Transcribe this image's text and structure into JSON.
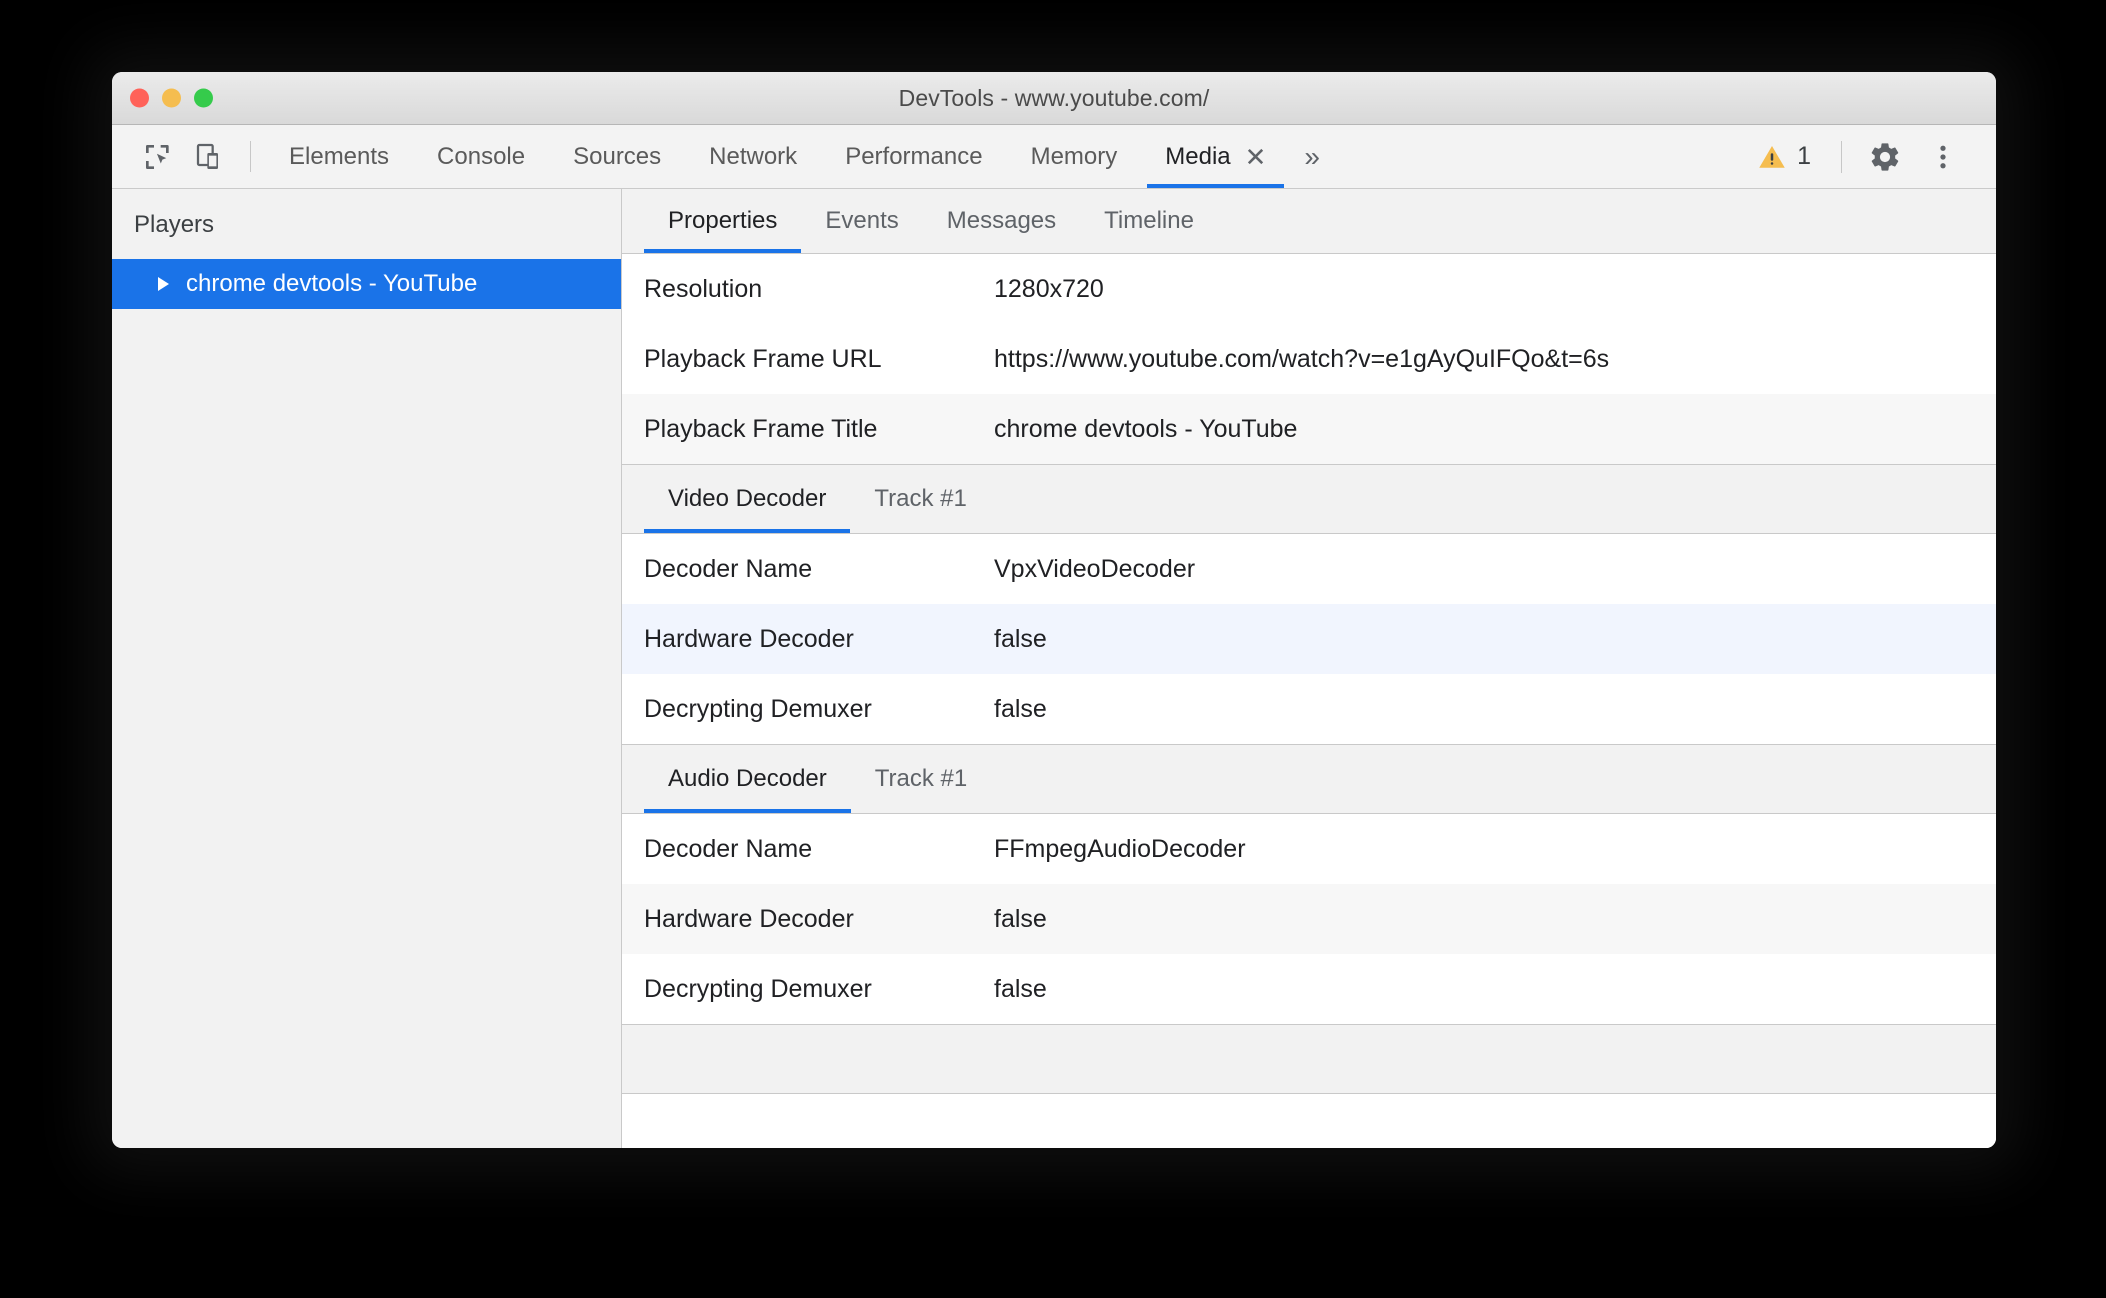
{
  "window": {
    "title": "DevTools - www.youtube.com/",
    "traffic_lights": [
      "close-red",
      "minimize-yellow",
      "zoom-green"
    ]
  },
  "toolbar": {
    "icons": [
      {
        "name": "inspect-element-icon",
        "label": "Inspect element"
      },
      {
        "name": "device-toolbar-icon",
        "label": "Toggle device toolbar"
      }
    ],
    "tabs": [
      {
        "label": "Elements",
        "active": false
      },
      {
        "label": "Console",
        "active": false
      },
      {
        "label": "Sources",
        "active": false
      },
      {
        "label": "Network",
        "active": false
      },
      {
        "label": "Performance",
        "active": false
      },
      {
        "label": "Memory",
        "active": false
      },
      {
        "label": "Media",
        "active": true,
        "closable": true
      }
    ],
    "close_glyph": "✕",
    "overflow_glyph": "»",
    "warning_count": "1",
    "settings_label": "Settings",
    "more_label": "Customize and control DevTools"
  },
  "sidebar": {
    "header": "Players",
    "items": [
      {
        "label": "chrome devtools - YouTube",
        "selected": true,
        "expanded": false
      }
    ]
  },
  "panel": {
    "tabs": [
      {
        "label": "Properties",
        "active": true
      },
      {
        "label": "Events",
        "active": false
      },
      {
        "label": "Messages",
        "active": false
      },
      {
        "label": "Timeline",
        "active": false
      }
    ],
    "general_rows": [
      {
        "name": "Resolution",
        "value": "1280x720"
      },
      {
        "name": "Playback Frame URL",
        "value": "https://www.youtube.com/watch?v=e1gAyQuIFQo&t=6s"
      },
      {
        "name": "Playback Frame Title",
        "value": "chrome devtools - YouTube"
      }
    ],
    "video_section": {
      "tabs": [
        {
          "label": "Video Decoder",
          "active": true
        },
        {
          "label": "Track #1",
          "active": false
        }
      ],
      "rows": [
        {
          "name": "Decoder Name",
          "value": "VpxVideoDecoder"
        },
        {
          "name": "Hardware Decoder",
          "value": "false"
        },
        {
          "name": "Decrypting Demuxer",
          "value": "false"
        }
      ]
    },
    "audio_section": {
      "tabs": [
        {
          "label": "Audio Decoder",
          "active": true
        },
        {
          "label": "Track #1",
          "active": false
        }
      ],
      "rows": [
        {
          "name": "Decoder Name",
          "value": "FFmpegAudioDecoder"
        },
        {
          "name": "Hardware Decoder",
          "value": "false"
        },
        {
          "name": "Decrypting Demuxer",
          "value": "false"
        }
      ]
    }
  },
  "colors": {
    "accent": "#1a73e8",
    "warning": "#f5bd4f",
    "selected_row": "#f1f5fe",
    "alt_row": "#f7f7f7",
    "chrome_bg": "#f2f2f2",
    "text": "#202124"
  }
}
